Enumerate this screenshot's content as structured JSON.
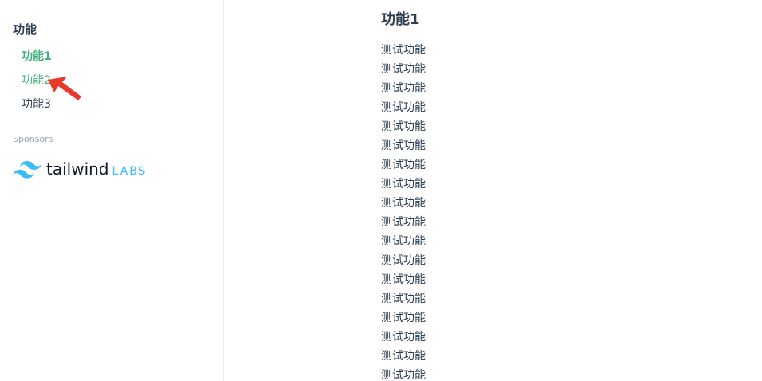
{
  "sidebar": {
    "heading": "功能",
    "items": [
      {
        "label": "功能1",
        "state": "active"
      },
      {
        "label": "功能2",
        "state": "hover"
      },
      {
        "label": "功能3",
        "state": "normal"
      }
    ],
    "sponsors_label": "Sponsors",
    "sponsor_logo": {
      "wordmark": "tailwind",
      "suffix": "LABS",
      "icon": "tailwind-wave-icon"
    }
  },
  "main": {
    "title": "功能1",
    "lines": [
      "测试功能",
      "测试功能",
      "测试功能",
      "测试功能",
      "测试功能",
      "测试功能",
      "测试功能",
      "测试功能",
      "测试功能",
      "测试功能",
      "测试功能",
      "测试功能",
      "测试功能",
      "测试功能",
      "测试功能",
      "测试功能",
      "测试功能",
      "测试功能"
    ]
  },
  "colors": {
    "accent": "#3eaf7c",
    "text": "#2c3e50",
    "muted": "#9aa3ad",
    "tailwind_blue": "#38bdf8",
    "annotation_arrow": "#e8392b"
  },
  "annotation": {
    "icon": "red-pointer-arrow-icon"
  }
}
